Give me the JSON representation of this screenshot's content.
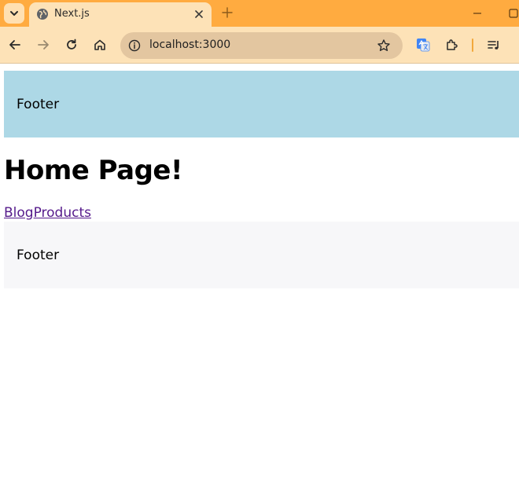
{
  "colors": {
    "tabstrip": "#ffab40",
    "toolbar": "#fde2b7",
    "omnibox": "#e3c6a0",
    "footer_top_bg": "#add8e6",
    "footer_bottom_bg": "#f7f7f9",
    "link": "#551a8b"
  },
  "browser": {
    "tab": {
      "title": "Next.js",
      "icon": "globe-icon"
    },
    "address": {
      "url": "localhost:3000"
    }
  },
  "page": {
    "header_footer_text": "Footer",
    "heading": "Home Page!",
    "links": [
      {
        "label": "Blog"
      },
      {
        "label": "Products"
      }
    ],
    "footer_text": "Footer"
  }
}
